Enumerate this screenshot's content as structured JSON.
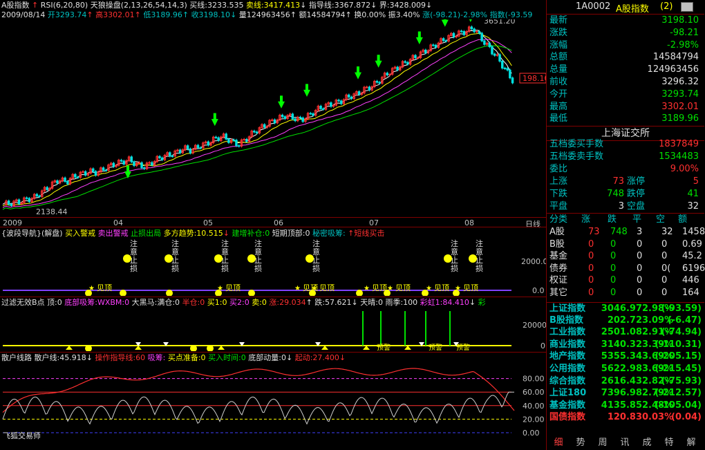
{
  "header": {
    "title": "A股指数",
    "indicator": "RSI(6,20,80)",
    "formula": "天狼操盘(2,13,26,54,14,3)",
    "buy_line": "买线:3233.535",
    "sell_line": "卖线:3417.413",
    "guide_line": "指导线:3367.872",
    "boundary": "界:3428.009",
    "date": "2009/08/14",
    "open": "开3293.74",
    "high": "高3302.01",
    "low": "低3189.96",
    "close": "收3198.10",
    "volume": "量124963456",
    "amount": "额14584794",
    "turnover": "换0.00%",
    "amplitude": "振3.40%",
    "change": "涨(-98.21)-2.98%",
    "index_label": "指数(-93.59"
  },
  "main_chart": {
    "high_label": "3651.20",
    "low_label": "2138.44",
    "last_price": "198.10",
    "time_axis": [
      "2009",
      "04",
      "05",
      "06",
      "07",
      "08"
    ],
    "period": "日线",
    "prices": [
      2138,
      2150,
      2160,
      2180,
      2200,
      2250,
      2300,
      2350,
      2330,
      2380,
      2400,
      2420,
      2410,
      2450,
      2480,
      2500,
      2520,
      2480,
      2460,
      2500,
      2540,
      2560,
      2580,
      2620,
      2600,
      2640,
      2660,
      2700,
      2720,
      2680,
      2650,
      2700,
      2760,
      2800,
      2840,
      2870,
      2900,
      2880,
      2860,
      2900,
      2950,
      2980,
      3000,
      3020,
      3060,
      3080,
      3120,
      3150,
      3200,
      3260,
      3300,
      3340,
      3380,
      3420,
      3460,
      3500,
      3540,
      3580,
      3600,
      3620,
      3651,
      3560,
      3480,
      3400,
      3300,
      3200
    ]
  },
  "panel1": {
    "title": "{波段导航}(解盘)",
    "items": [
      "买入警戒",
      "卖出警戒",
      "止损出局",
      "多方趋势:10.515",
      "建增补仓:0",
      "短期顶部:0",
      "秘密吸筹:",
      "短线买击"
    ],
    "annotations": [
      "注意止损",
      "注意止损",
      "注意止损",
      "注意止损",
      "注意止损",
      "注意止损",
      "注意止损"
    ],
    "markers": [
      "见顶",
      "见顶",
      "见顶",
      "见顶",
      "见顶",
      "见顶",
      "见顶",
      "见顶"
    ],
    "y_labels": [
      "2000.0",
      "0.0"
    ]
  },
  "panel2": {
    "title": "过滤无效B点",
    "items": [
      "顶:0",
      "底部吸筹:WXBM:0",
      "大黑马:满仓:0",
      "半仓:0",
      "买1:0",
      "买2:0",
      "卖:0",
      "涨:29.034",
      "跌:57.621",
      "天晴:0",
      "雨季:100",
      "彩虹1:84.410",
      "彩"
    ],
    "markers": [
      "预警",
      "预警",
      "预警"
    ],
    "y_labels": [
      "20000",
      "0"
    ]
  },
  "panel3": {
    "title": "散户线路",
    "items": [
      "散户线:45.918",
      "操作指导线:60",
      "吸筹:",
      "买点准备:0",
      "买入时间:0",
      "底部动量:0",
      "起动:27.400"
    ],
    "y_labels": [
      "80.00",
      "60.00",
      "40.00",
      "20.00",
      "0.00"
    ],
    "footer": "飞狐交易师"
  },
  "right_panel": {
    "code": "1A0002",
    "name": "A股指数",
    "num": "(2)",
    "quote_rows": [
      {
        "label": "最新",
        "value": "3198.10",
        "color": "#00e000"
      },
      {
        "label": "涨跌",
        "value": "-98.21",
        "color": "#00e000"
      },
      {
        "label": "涨幅",
        "value": "-2.98%",
        "color": "#00e000"
      },
      {
        "label": "总额",
        "value": "14584794",
        "color": "#e0e0e0"
      },
      {
        "label": "总量",
        "value": "124963456",
        "color": "#e0e0e0"
      },
      {
        "label": "前收",
        "value": "3296.32",
        "color": "#e0e0e0"
      },
      {
        "label": "今开",
        "value": "3293.74",
        "color": "#00e000"
      },
      {
        "label": "最高",
        "value": "3302.01",
        "color": "#ff3030"
      },
      {
        "label": "最低",
        "value": "3189.96",
        "color": "#00e000"
      }
    ],
    "exchange": "上海证交所",
    "bid_ask": [
      {
        "label": "五档委买手数",
        "value": "1837849",
        "color": "#ff3030"
      },
      {
        "label": "五档委卖手数",
        "value": "1534483",
        "color": "#00e000"
      },
      {
        "label": "委比",
        "value": "9.00%",
        "color": "#ff3030"
      }
    ],
    "up_down": [
      {
        "l1": "上涨",
        "v1": "73",
        "c1": "#ff3030",
        "l2": "涨停",
        "v2": "5",
        "c2": "#ff3030"
      },
      {
        "l1": "下跌",
        "v1": "748",
        "c1": "#00e000",
        "l2": "跌停",
        "v2": "41",
        "c2": "#00e000"
      },
      {
        "l1": "平盘",
        "v1": "3",
        "c1": "#e0e0e0",
        "l2": "空盘",
        "v2": "32",
        "c2": "#e0e0e0"
      }
    ],
    "breadth_header": [
      "分类",
      "涨",
      "跌",
      "平",
      "空",
      "额"
    ],
    "breadth": [
      {
        "cat": "A股",
        "up": "73",
        "down": "748",
        "flat": "3",
        "empty": "32",
        "amt": "1458"
      },
      {
        "cat": "B股",
        "up": "0",
        "down": "0",
        "flat": "0",
        "empty": "0",
        "amt": "0.69"
      },
      {
        "cat": "基金",
        "up": "0",
        "down": "0",
        "flat": "0",
        "empty": "0",
        "amt": "45.2"
      },
      {
        "cat": "债券",
        "up": "0",
        "down": "0",
        "flat": "0",
        "empty": "0(",
        "amt": "6196"
      },
      {
        "cat": "权证",
        "up": "0",
        "down": "0",
        "flat": "0",
        "empty": "0",
        "amt": "446"
      },
      {
        "cat": "其它",
        "up": "0",
        "down": "0",
        "flat": "0",
        "empty": "0",
        "amt": "164"
      }
    ],
    "indices": [
      {
        "name": "上证指数",
        "value": "3046.97",
        "pct": "2.98%",
        "chg": "(-93.59)"
      },
      {
        "name": "B股指数",
        "value": "202.72",
        "pct": "3.09%",
        "chg": "(-6.47)"
      },
      {
        "name": "工业指数",
        "value": "2501.08",
        "pct": "2.91%",
        "chg": "(-74.94)"
      },
      {
        "name": "商业指数",
        "value": "3140.32",
        "pct": "3.39%",
        "chg": "(-110.31)"
      },
      {
        "name": "地产指数",
        "value": "5355.34",
        "pct": "3.69%",
        "chg": "(-205.15)"
      },
      {
        "name": "公用指数",
        "value": "5622.98",
        "pct": "3.69%",
        "chg": "(-215.45)"
      },
      {
        "name": "综合指数",
        "value": "2616.43",
        "pct": "2.82%",
        "chg": "(-75.93)"
      },
      {
        "name": "上证180",
        "value": "7396.98",
        "pct": "2.79%",
        "chg": "(-212.57)"
      },
      {
        "name": "基金指数",
        "value": "4135.85",
        "pct": "2.48%",
        "chg": "(-105.04)"
      },
      {
        "name": "国债指数",
        "value": "120.83",
        "pct": "0.03%",
        "chg": "(0.04)"
      }
    ],
    "tabs": [
      "细",
      "势",
      "周",
      "讯",
      "成",
      "特",
      "解"
    ]
  },
  "colors": {
    "up": "#ff3030",
    "down": "#00e000",
    "border": "#800000",
    "label": "#00c0c0"
  }
}
